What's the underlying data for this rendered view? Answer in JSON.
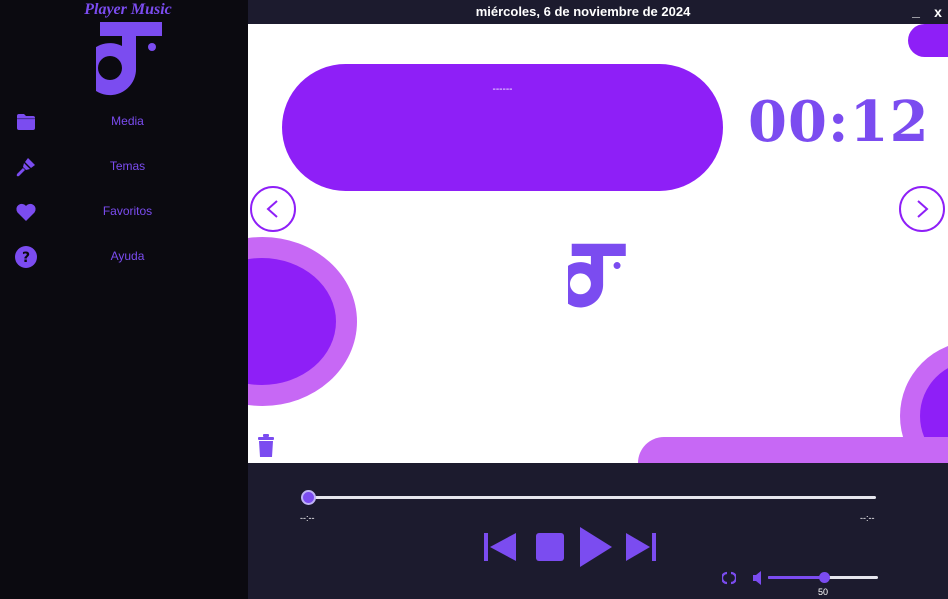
{
  "app": {
    "title": "Player Music",
    "accent": "#7b4cf0",
    "pill_color": "#8e1ff7",
    "deco_color": "#c768f5"
  },
  "sidebar": {
    "items": [
      {
        "label": "Media",
        "icon": "folder-icon"
      },
      {
        "label": "Temas",
        "icon": "paint-brush-icon"
      },
      {
        "label": "Favoritos",
        "icon": "heart-icon"
      },
      {
        "label": "Ayuda",
        "icon": "help-icon"
      }
    ]
  },
  "titlebar": {
    "date": "miércoles, 6 de noviembre de 2024",
    "minimize": "_",
    "close": "x"
  },
  "now_playing": {
    "title": "------",
    "time": "00:12"
  },
  "player": {
    "elapsed": "--:--",
    "total": "--:--",
    "progress": 0.0,
    "volume": 50,
    "volume_label": "50"
  }
}
